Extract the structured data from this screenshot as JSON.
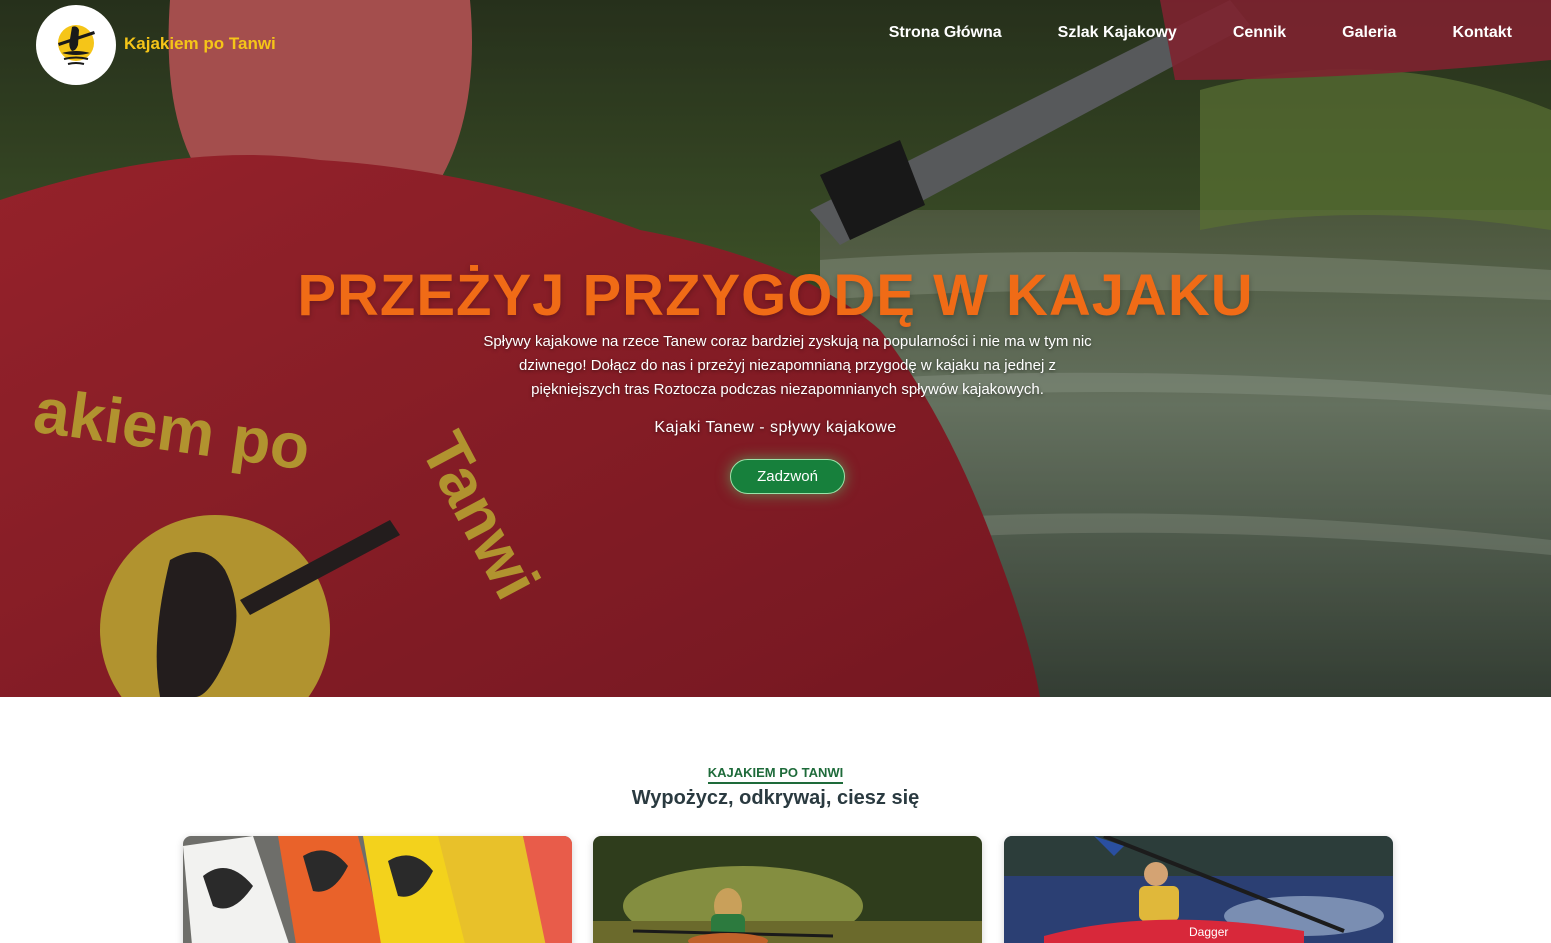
{
  "brand": {
    "name": "Kajakiem po Tanwi",
    "logo_icon": "kayaker-sun-logo-icon"
  },
  "nav": {
    "items": [
      {
        "label": "Strona Główna"
      },
      {
        "label": "Szlak Kajakowy"
      },
      {
        "label": "Cennik"
      },
      {
        "label": "Galeria"
      },
      {
        "label": "Kontakt"
      }
    ]
  },
  "hero": {
    "title": "PRZEŻYJ PRZYGODĘ W KAJAKU",
    "text": "Spływy kajakowe na rzece Tanew coraz bardziej zyskują na popularności i nie ma w tym nic dziwnego! Dołącz do nas i przeżyj niezapomnianą przygodę w kajaku na jednej z piękniejszych tras Roztocza podczas niezapomnianych spływów kajakowych.",
    "subtitle": "Kajaki Tanew - spływy kajakowe",
    "cta_label": "Zadzwoń",
    "shirt_text": "Kajakiem po Tanwi"
  },
  "section": {
    "eyebrow": "KAJAKIEM PO TANWI",
    "title": "Wypożycz, odkrywaj, ciesz się"
  },
  "colors": {
    "accent_orange": "#f06b16",
    "brand_yellow": "#f5c518",
    "button_green": "#17803c",
    "heading_dark": "#2a3a40"
  }
}
